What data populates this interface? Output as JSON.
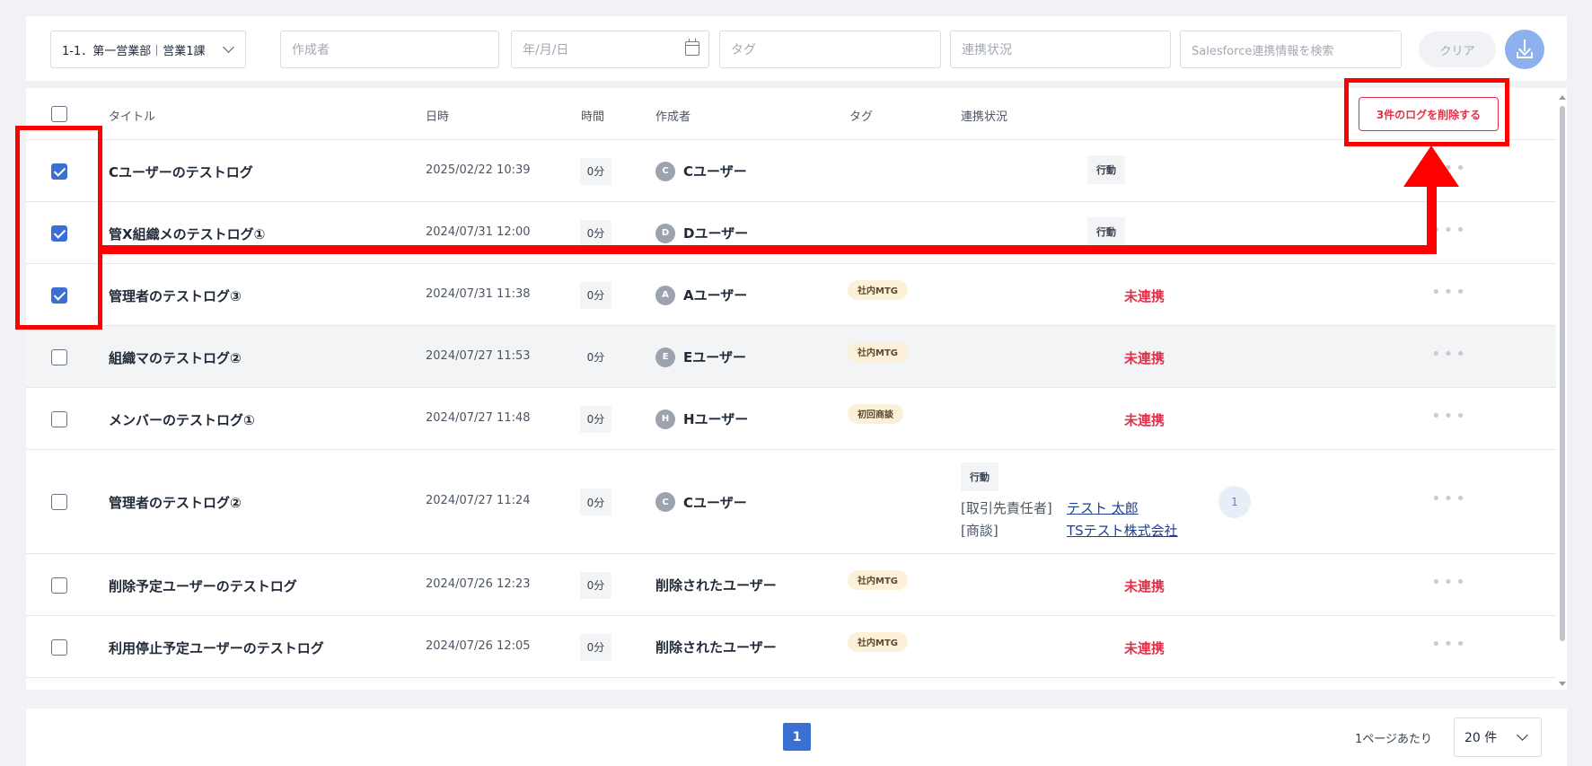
{
  "filters": {
    "department": "1-1．第一営業部｜営業1課",
    "author_placeholder": "作成者",
    "date_placeholder": "年/月/日",
    "tag_placeholder": "タグ",
    "status_placeholder": "連携状況",
    "salesforce_placeholder": "Salesforce連携情報を検索",
    "clear_label": "クリア"
  },
  "table": {
    "headers": {
      "title": "タイトル",
      "date": "日時",
      "duration": "時間",
      "author": "作成者",
      "tag": "タグ",
      "status": "連携状況"
    },
    "delete_button": "3件のログを削除する",
    "rows": [
      {
        "checked": true,
        "title": "Cユーザーのテストログ",
        "date": "2025/02/22 10:39",
        "duration": "0分",
        "avatar": "C",
        "author": "Cユーザー",
        "tag": "",
        "status_type": "action",
        "status_action": "行動"
      },
      {
        "checked": true,
        "title": "管X組織メのテストログ①",
        "date": "2024/07/31 12:00",
        "duration": "0分",
        "avatar": "D",
        "author": "Dユーザー",
        "tag": "",
        "status_type": "action",
        "status_action": "行動"
      },
      {
        "checked": true,
        "title": "管理者のテストログ③",
        "date": "2024/07/31 11:38",
        "duration": "0分",
        "avatar": "A",
        "author": "Aユーザー",
        "tag": "社内MTG",
        "status_type": "unlinked",
        "status_text": "未連携"
      },
      {
        "checked": false,
        "title": "組織マのテストログ②",
        "date": "2024/07/27 11:53",
        "duration": "0分",
        "avatar": "E",
        "author": "Eユーザー",
        "tag": "社内MTG",
        "status_type": "unlinked",
        "status_text": "未連携"
      },
      {
        "checked": false,
        "title": "メンバーのテストログ①",
        "date": "2024/07/27 11:48",
        "duration": "0分",
        "avatar": "H",
        "author": "Hユーザー",
        "tag": "初回商談",
        "status_type": "unlinked",
        "status_text": "未連携"
      },
      {
        "checked": false,
        "title": "管理者のテストログ②",
        "date": "2024/07/27 11:24",
        "duration": "0分",
        "avatar": "C",
        "author": "Cユーザー",
        "tag": "",
        "status_type": "linked",
        "status_action": "行動",
        "contact_label": "[取引先責任者]",
        "contact_value": "テスト 太郎",
        "deal_label": "[商談]",
        "deal_value": "TSテスト株式会社",
        "count": "1"
      },
      {
        "checked": false,
        "title": "削除予定ユーザーのテストログ",
        "date": "2024/07/26 12:23",
        "duration": "0分",
        "avatar": "",
        "author": "削除されたユーザー",
        "tag": "社内MTG",
        "status_type": "unlinked",
        "status_text": "未連携"
      },
      {
        "checked": false,
        "title": "利用停止予定ユーザーのテストログ",
        "date": "2024/07/26 12:05",
        "duration": "0分",
        "avatar": "",
        "author": "削除されたユーザー",
        "tag": "社内MTG",
        "status_type": "unlinked",
        "status_text": "未連携"
      }
    ]
  },
  "pagination": {
    "current_page": "1",
    "per_page_label": "1ページあたり",
    "per_page_value": "20 件"
  },
  "colors": {
    "primary": "#3b6fd4",
    "danger": "#e0324a",
    "annotation": "#ff0000"
  }
}
